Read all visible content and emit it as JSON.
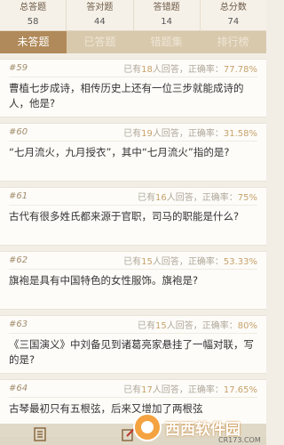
{
  "stats": [
    {
      "label": "总答题",
      "value": "58"
    },
    {
      "label": "答对题",
      "value": "44"
    },
    {
      "label": "答错题",
      "value": "14"
    },
    {
      "label": "总分数",
      "value": "74"
    }
  ],
  "tabs": [
    {
      "label": "未答题",
      "active": true
    },
    {
      "label": "已答题",
      "active": false
    },
    {
      "label": "错题集",
      "active": false
    },
    {
      "label": "排行榜",
      "active": false
    }
  ],
  "meta": {
    "prefix": "已有",
    "suffix": "人回答，正确率："
  },
  "questions": [
    {
      "num": "#59",
      "answered": "18",
      "rate": "77.78%",
      "text": "曹植七步成诗，相传历史上还有一位三步就能成诗的人，他是?"
    },
    {
      "num": "#60",
      "answered": "19",
      "rate": "31.58%",
      "text": "“七月流火，九月授衣”，其中“七月流火”指的是?"
    },
    {
      "num": "#61",
      "answered": "16",
      "rate": "75%",
      "text": "古代有很多姓氏都来源于官职，司马的职能是什么?"
    },
    {
      "num": "#62",
      "answered": "15",
      "rate": "53.33%",
      "text": "旗袍是具有中国特色的女性服饰。旗袍是?"
    },
    {
      "num": "#63",
      "answered": "15",
      "rate": "80%",
      "text": "《三国演义》中刘备见到诸葛亮家悬挂了一幅对联，写的是?"
    },
    {
      "num": "#64",
      "answered": "17",
      "rate": "17.65%",
      "text": "古琴最初只有五根弦，后来又增加了两根弦"
    }
  ],
  "watermark": {
    "text": "西西软件园",
    "sub": "CR173.COM"
  },
  "colors": {
    "accent": "#b08a5a",
    "highlight": "#c7a26a",
    "background": "#f2eee6"
  },
  "icons": [
    "list-icon",
    "edit-icon"
  ]
}
